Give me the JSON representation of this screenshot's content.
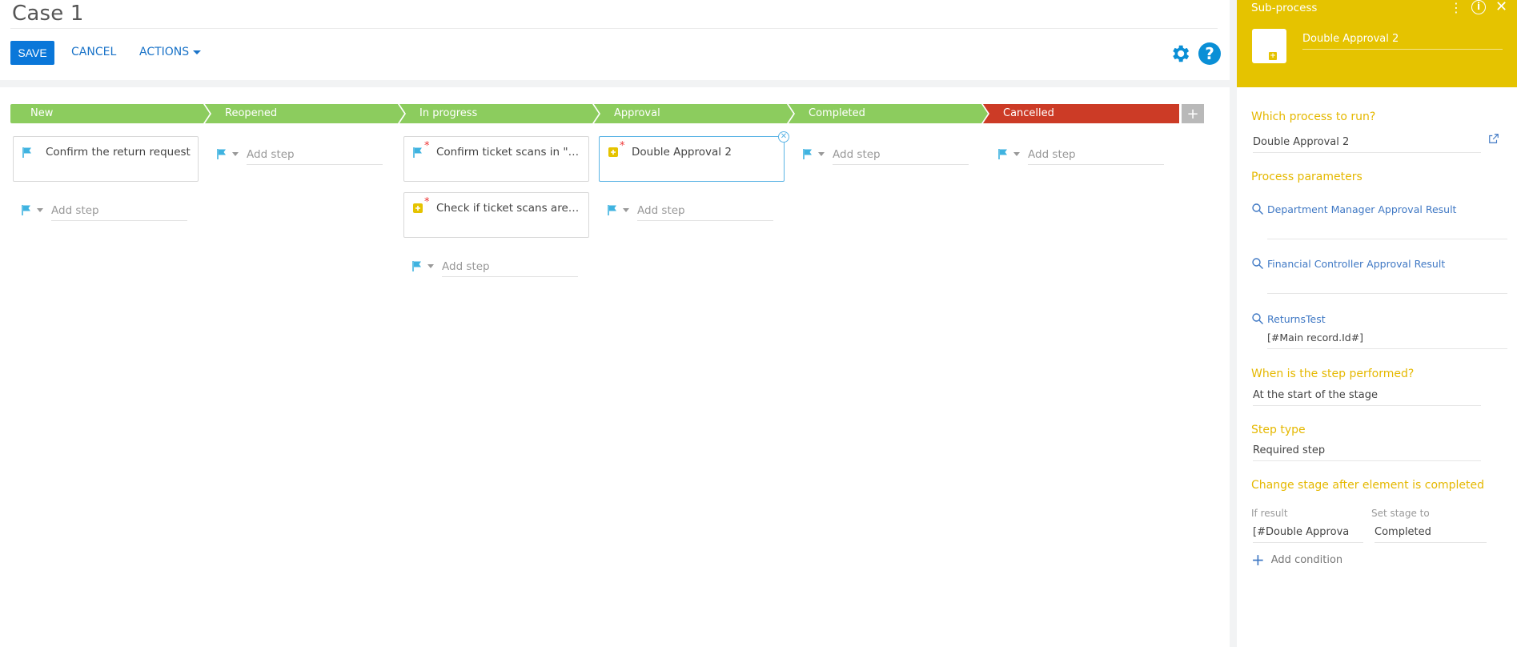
{
  "header": {
    "title": "Case 1",
    "save_label": "SAVE",
    "cancel_label": "CANCEL",
    "actions_label": "ACTIONS"
  },
  "stages": [
    {
      "label": "New",
      "color": "#8ccc5e"
    },
    {
      "label": "Reopened",
      "color": "#8ccc5e"
    },
    {
      "label": "In progress",
      "color": "#8ccc5e"
    },
    {
      "label": "Approval",
      "color": "#8ccc5e"
    },
    {
      "label": "Completed",
      "color": "#8ccc5e"
    },
    {
      "label": "Cancelled",
      "color": "#cc3b26"
    }
  ],
  "add_stage_label": "+",
  "steps": {
    "new": {
      "card": "Confirm the return request",
      "add": "Add step"
    },
    "reopened": {
      "add": "Add step"
    },
    "in_progress": {
      "card1": "Confirm ticket scans in \"Att...",
      "card2": "Check if ticket scans are att...",
      "add": "Add step"
    },
    "approval": {
      "card": "Double Approval 2",
      "add": "Add step"
    },
    "completed": {
      "add": "Add step"
    },
    "cancelled": {
      "add": "Add step"
    }
  },
  "panel": {
    "title": "Sub-process",
    "name": "Double Approval 2",
    "which_process_label": "Which process to run?",
    "which_process_value": "Double Approval 2",
    "params_label": "Process parameters",
    "params": [
      {
        "name": "Department Manager Approval Result",
        "value": ""
      },
      {
        "name": "Financial Controller Approval Result",
        "value": ""
      },
      {
        "name": "ReturnsTest",
        "value": "[#Main record.Id#]"
      }
    ],
    "when_label": "When is the step performed?",
    "when_value": "At the start of the stage",
    "type_label": "Step type",
    "type_value": "Required step",
    "change_stage_label": "Change stage after element is completed",
    "if_result_label": "If result",
    "if_result_value": "[#Double Approva",
    "set_stage_label": "Set stage to",
    "set_stage_value": "Completed",
    "add_condition_label": "Add condition"
  },
  "colors": {
    "accent_blue": "#0a77d9",
    "panel_yellow": "#e5c300",
    "stage_green": "#8ccc5e",
    "stage_red": "#cc3b26",
    "flag_blue": "#3fb3e0"
  },
  "icons": [
    "gear-icon",
    "help-icon",
    "flag-icon",
    "subprocess-icon",
    "search-icon",
    "external-link-icon",
    "info-icon",
    "close-icon",
    "kebab-icon"
  ]
}
